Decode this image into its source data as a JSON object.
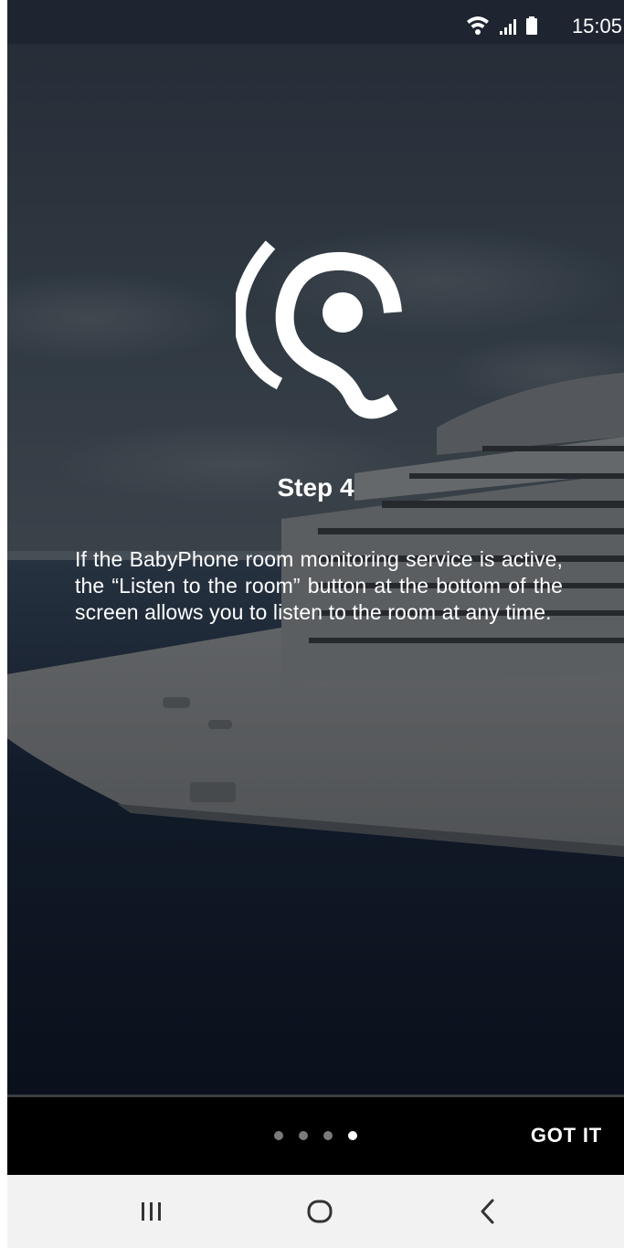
{
  "status_bar": {
    "time": "15:05",
    "icons": [
      "wifi-icon",
      "signal-icon",
      "battery-icon"
    ]
  },
  "onboarding": {
    "icon": "ear-listen-icon",
    "title": "Step 4",
    "body": "If the BabyPhone room monitoring service is active, the “Listen to the room” button at the bottom of the screen allows you to listen to the room at any time."
  },
  "pager": {
    "total_pages": 4,
    "current_page": 4,
    "got_it_label": "GOT IT"
  },
  "nav_bar": {
    "buttons": [
      "recent-apps-icon",
      "home-icon",
      "back-icon"
    ]
  },
  "colors": {
    "status_bar": "#1e2530",
    "pager_bar": "#000000",
    "dot_inactive": "#7a7a7a",
    "dot_active": "#ffffff",
    "nav_bar": "#f2f2f2"
  }
}
